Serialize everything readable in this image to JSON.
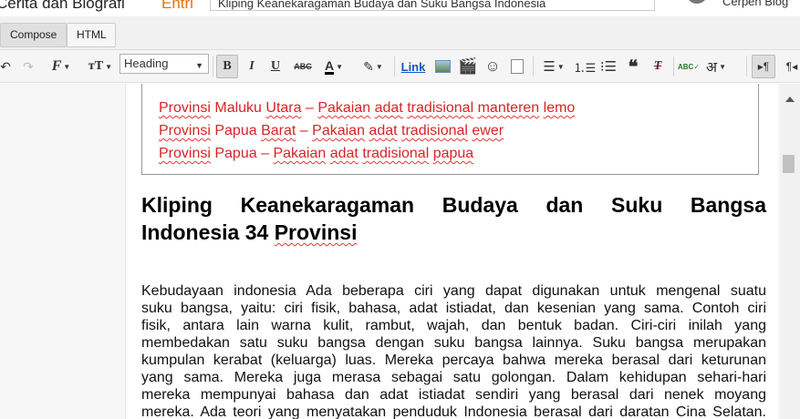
{
  "topbar": {
    "blog_title": "Cerita dan Biografi",
    "mode_label": "Entri",
    "post_title": "Kliping Keanekaragaman Budaya dan Suku Bangsa Indonesia",
    "user": "Cerpen Blog"
  },
  "modes": {
    "compose": "Compose",
    "html": "HTML"
  },
  "toolbar": {
    "heading_value": "Heading",
    "link_label": "Link",
    "bold": "B",
    "italic": "I",
    "underline": "U",
    "strike": "ABC",
    "text_color": "A",
    "lang": "अ"
  },
  "table_lines": [
    {
      "words": [
        "Provinsi",
        "Maluku",
        "Utara",
        "–",
        "Pakaian",
        "adat",
        "tradisional",
        "manteren",
        "lemo"
      ]
    },
    {
      "words": [
        "Provinsi",
        "Papua",
        "Barat",
        "–",
        "Pakaian",
        "adat",
        "tradisional",
        "ewer"
      ]
    },
    {
      "words": [
        "Provinsi",
        "Papua",
        "–",
        " Pakaian",
        "adat",
        "tradisional",
        "papua"
      ]
    }
  ],
  "heading": {
    "line1": "Kliping Keanekaragaman Budaya dan Suku Bangsa",
    "line2a": "Indonesia 34 ",
    "line2b": "Provinsi"
  },
  "paragraph": [
    "Kebudayaan indonesia Ada beberapa ciri yang dapat digunakan untuk mengenal suatu",
    "suku bangsa, yaitu: ciri fisik, bahasa, adat istiadat, dan kesenian yang sama. Contoh ciri",
    "fisik, antara lain warna kulit, rambut, wajah, dan bentuk badan. Ciri-ciri inilah yang",
    "membedakan satu suku bangsa dengan suku bangsa lainnya. Suku bangsa merupakan",
    "kumpulan kerabat (keluarga) luas. Mereka percaya bahwa mereka berasal dari keturunan",
    "yang sama. Mereka juga merasa sebagai satu golongan. Dalam kehidupan sehari-hari",
    "mereka mempunyai bahasa dan adat istiadat sendiri yang berasal dari nenek moyang",
    "mereka. Ada teori yang menyatakan penduduk Indonesia berasal dari daratan Cina Selatan."
  ],
  "colors": {
    "link_red": "#d62525",
    "accent_orange": "#e8710a"
  }
}
